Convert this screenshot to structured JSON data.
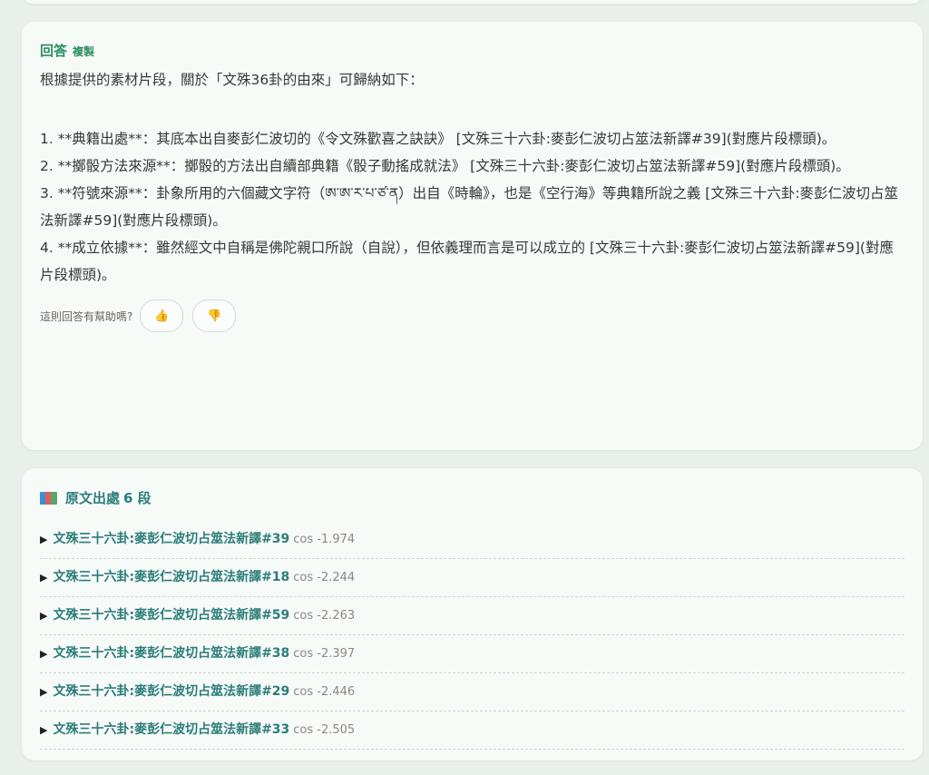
{
  "answer": {
    "title": "回答",
    "copy_label": "複製",
    "intro": "根據提供的素材片段，關於「文殊36卦的由來」可歸納如下：",
    "items": [
      "1. **典籍出處**：其底本出自麥彭仁波切的《令文殊歡喜之訣訣》 [文殊三十六卦:麥彭仁波切占筮法新譯#39](對應片段標頭)。",
      "2. **擲骰方法來源**：擲骰的方法出自續部典籍《骰子動搖成就法》 [文殊三十六卦:麥彭仁波切占筮法新譯#59](對應片段標頭)。",
      "3. **符號來源**：卦象所用的六個藏文字符（ཨ་ཨ་ར་པ་ཙ་ན）出自《時輪》，也是《空行海》等典籍所說之義 [文殊三十六卦:麥彭仁波切占筮法新譯#59](對應片段標頭)。",
      "4. **成立依據**：雖然經文中自稱是佛陀親口所說（自說），但依義理而言是可以成立的 [文殊三十六卦:麥彭仁波切占筮法新譯#59](對應片段標頭)。"
    ],
    "feedback_label": "這則回答有幫助嗎?",
    "thumbs_up": "👍",
    "thumbs_down": "👎"
  },
  "sources": {
    "title": "原文出處",
    "count": "6 段",
    "icon": "books-icon",
    "items": [
      {
        "title": "文殊三十六卦:麥彭仁波切占筮法新譯#39",
        "score": "cos -1.974"
      },
      {
        "title": "文殊三十六卦:麥彭仁波切占筮法新譯#18",
        "score": "cos -2.244"
      },
      {
        "title": "文殊三十六卦:麥彭仁波切占筮法新譯#59",
        "score": "cos -2.263"
      },
      {
        "title": "文殊三十六卦:麥彭仁波切占筮法新譯#38",
        "score": "cos -2.397"
      },
      {
        "title": "文殊三十六卦:麥彭仁波切占筮法新譯#29",
        "score": "cos -2.446"
      },
      {
        "title": "文殊三十六卦:麥彭仁波切占筮法新譯#33",
        "score": "cos -2.505"
      }
    ]
  },
  "colors": {
    "accent_green": "#2a8f5e",
    "link_teal": "#2b7d7a",
    "page_bg": "#e9efea",
    "card_bg": "#f7fbf8"
  }
}
